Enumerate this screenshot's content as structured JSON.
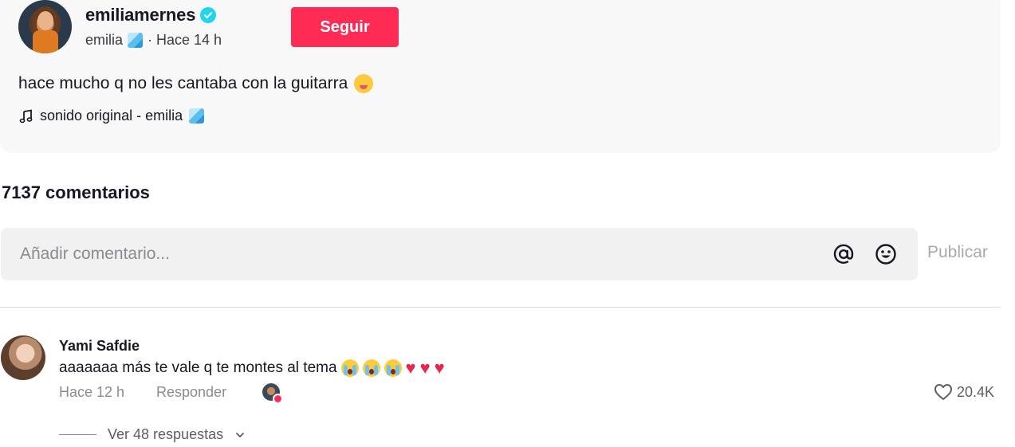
{
  "post": {
    "username": "emiliamernes",
    "display_name": "emilia",
    "time_ago": "· Hace 14 h",
    "follow_label": "Seguir",
    "caption": "hace mucho q no les cantaba con la guitarra",
    "sound": "sonido original - emilia"
  },
  "comments_header": {
    "count_label": "7137 comentarios"
  },
  "comment_input": {
    "placeholder": "Añadir comentario...",
    "post_label": "Publicar"
  },
  "comments": [
    {
      "author": "Yami Safdie",
      "text": "aaaaaaa más te vale q te montes al tema",
      "emojis": [
        "crying-face",
        "crying-face",
        "crying-face",
        "heart",
        "heart",
        "heart"
      ],
      "time": "Hace 12 h",
      "reply_label": "Responder",
      "likes": "20.4K",
      "view_replies": "Ver 48 respuestas"
    }
  ],
  "colors": {
    "accent": "#fe2c55",
    "verified": "#20d5ec",
    "muted_text": "#8a8b91"
  }
}
